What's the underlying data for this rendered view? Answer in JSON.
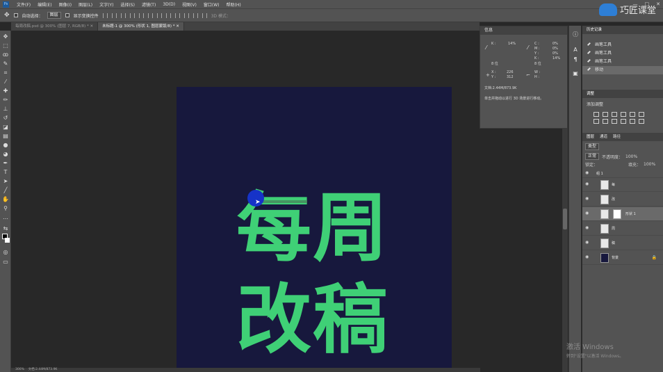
{
  "app": {
    "menu": [
      "文件(F)",
      "编辑(E)",
      "图像(I)",
      "图层(L)",
      "文字(Y)",
      "选择(S)",
      "滤镜(T)",
      "3D(D)",
      "视图(V)",
      "窗口(W)",
      "帮助(H)"
    ],
    "window_controls": [
      "—",
      "□",
      "✕"
    ]
  },
  "options_bar": {
    "auto_select_label": "自动选择：",
    "auto_select_value": "图层",
    "show_transform_label": "显示变换控件",
    "mode_3d_label": "3D 模式："
  },
  "brand": {
    "text": "巧匠课堂"
  },
  "tabs": [
    {
      "label": "每周改稿.psd @ 300% (图层 7, RGB/8) *",
      "active": false
    },
    {
      "label": "未标题-1 @ 300% (形状 1, 图层蒙版/8) *",
      "active": true
    }
  ],
  "artboard": {
    "bg_color": "#17183d",
    "text_color": "#3fd076",
    "chars_row1": [
      "每",
      "周"
    ],
    "chars_row2": [
      "改",
      "稿"
    ]
  },
  "status": {
    "zoom": "300%",
    "doc": "文档:2.44M/873.9K"
  },
  "info_panel": {
    "title": "信息",
    "k_label": "K :",
    "k_value": "14%",
    "c_label": "C :",
    "c_value": "0%",
    "m_label": "M :",
    "m_value": "0%",
    "y_label": "Y :",
    "y_value": "0%",
    "k2_label": "K :",
    "k2_value": "14%",
    "bit_left": "8 位",
    "bit_right": "8 位",
    "x_label": "X :",
    "x_value": "226",
    "y2_label": "Y :",
    "y2_value": "312",
    "w_label": "W :",
    "h_label": "H :",
    "doc_size": "文档:2.44M/873.9K",
    "hint": "单击并拖动以进行 3D 场景进行移动。"
  },
  "history_panel": {
    "title": "历史记录",
    "items": [
      {
        "label": "画笔工具",
        "selected": false
      },
      {
        "label": "画笔工具",
        "selected": false
      },
      {
        "label": "画笔工具",
        "selected": false
      },
      {
        "label": "移动",
        "selected": true
      }
    ]
  },
  "adjust_panel": {
    "title": "调整",
    "subtitle": "添加调整"
  },
  "layers_panel": {
    "tabs": [
      "图层",
      "通道",
      "路径"
    ],
    "filter_label": "类型",
    "blend_mode": "正常",
    "opacity_label": "不透明度：",
    "opacity_value": "100%",
    "lock_label": "锁定：",
    "fill_label": "填充：",
    "fill_value": "100%",
    "group_name": "组 1",
    "layers": [
      {
        "name": "每",
        "thumb": "light"
      },
      {
        "name": "改",
        "thumb": "light"
      },
      {
        "name": "形状 1",
        "thumb": "light",
        "has_mask": true,
        "selected": true
      },
      {
        "name": "周",
        "thumb": "light"
      },
      {
        "name": "稿",
        "thumb": "light"
      },
      {
        "name": "背景",
        "thumb": "dark",
        "locked": true
      }
    ]
  },
  "watermark": {
    "line1": "激活 Windows",
    "line2": "转到\"设置\"以激活 Windows。"
  }
}
